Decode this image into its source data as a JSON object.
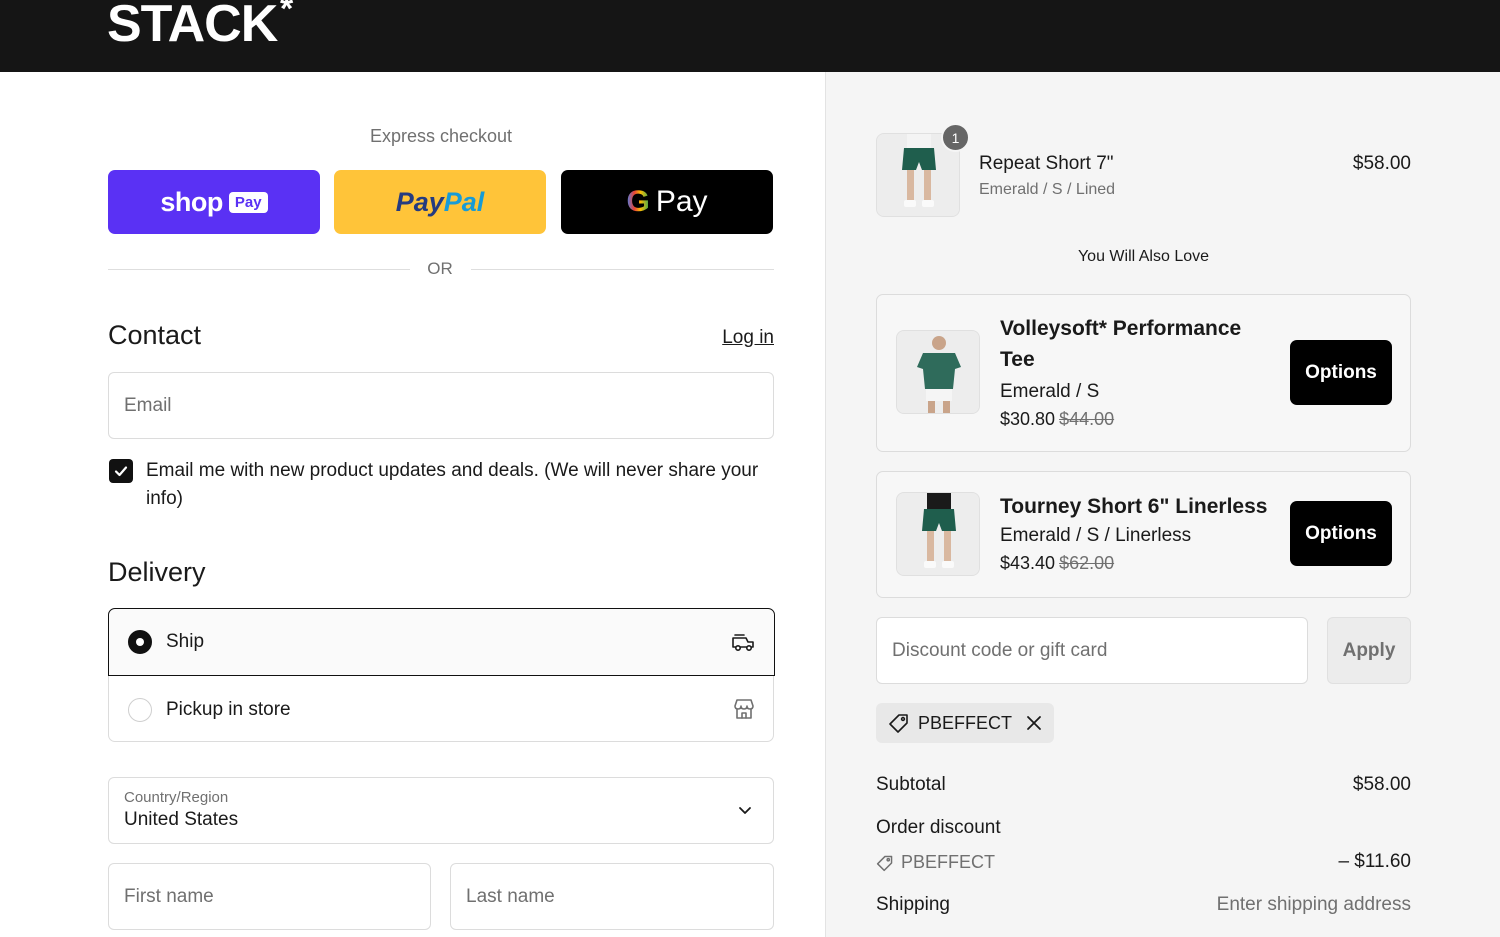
{
  "brand": {
    "logo": "STACK",
    "logo_mark": "*"
  },
  "express": {
    "title": "Express checkout",
    "shop_word": "shop",
    "shop_badge": "Pay",
    "paypal_a": "Pay",
    "paypal_b": "Pal",
    "gpay_g": "G",
    "gpay_word": "Pay",
    "or": "OR"
  },
  "contact": {
    "heading": "Contact",
    "login": "Log in",
    "email_placeholder": "Email",
    "newsletter_label": "Email me with new product updates and deals. (We will never share your info)",
    "newsletter_checked": true
  },
  "delivery": {
    "heading": "Delivery",
    "options": [
      {
        "label": "Ship",
        "selected": true,
        "icon": "truck-icon"
      },
      {
        "label": "Pickup in store",
        "selected": false,
        "icon": "store-icon"
      }
    ],
    "country_label": "Country/Region",
    "country_value": "United States",
    "first_name_placeholder": "First name",
    "last_name_placeholder": "Last name"
  },
  "cart": {
    "item": {
      "quantity": "1",
      "name": "Repeat Short 7\"",
      "variant": "Emerald / S / Lined",
      "price": "$58.00"
    },
    "recommend_title": "You Will Also Love",
    "recommendations": [
      {
        "name": "Volleysoft* Performance Tee",
        "variant": "Emerald / S",
        "price": "$30.80",
        "old_price": "$44.00",
        "button": "Options"
      },
      {
        "name": "Tourney Short 6\" Linerless",
        "variant": "Emerald / S / Linerless",
        "price": "$43.40",
        "old_price": "$62.00",
        "button": "Options"
      }
    ],
    "discount_placeholder": "Discount code or gift card",
    "apply": "Apply",
    "applied_code": "PBEFFECT"
  },
  "summary": {
    "subtotal_label": "Subtotal",
    "subtotal_value": "$58.00",
    "discount_label": "Order discount",
    "discount_code": "PBEFFECT",
    "discount_value": "– $11.60",
    "shipping_label": "Shipping",
    "shipping_value": "Enter shipping address"
  },
  "colors": {
    "shop_pay": "#5a31f4",
    "paypal": "#ffc439",
    "gpay": "#000000",
    "header": "#151515",
    "sidebar": "#f5f5f5"
  }
}
